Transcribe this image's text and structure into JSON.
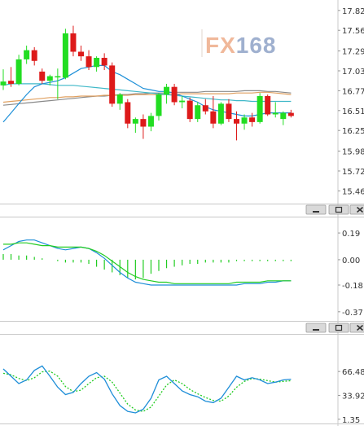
{
  "chart_data": [
    {
      "type": "candlestick",
      "panel": "price",
      "watermark": "FX168",
      "y_ticks": [
        "17.82",
        "17.56",
        "17.29",
        "17.03",
        "16.77",
        "16.51",
        "16.25",
        "15.98",
        "15.72",
        "15.46"
      ],
      "ylim": [
        15.4,
        17.85
      ],
      "candles": [
        {
          "o": 16.84,
          "h": 17.05,
          "l": 16.78,
          "c": 16.89
        },
        {
          "o": 16.9,
          "h": 17.08,
          "l": 16.82,
          "c": 16.86
        },
        {
          "o": 16.86,
          "h": 17.24,
          "l": 16.84,
          "c": 17.18
        },
        {
          "o": 17.18,
          "h": 17.36,
          "l": 17.12,
          "c": 17.3
        },
        {
          "o": 17.3,
          "h": 17.34,
          "l": 17.1,
          "c": 17.16
        },
        {
          "o": 17.02,
          "h": 17.06,
          "l": 16.86,
          "c": 16.9
        },
        {
          "o": 16.9,
          "h": 16.98,
          "l": 16.84,
          "c": 16.96
        },
        {
          "o": 16.96,
          "h": 17.06,
          "l": 16.66,
          "c": 16.96
        },
        {
          "o": 16.94,
          "h": 17.58,
          "l": 16.92,
          "c": 17.52
        },
        {
          "o": 17.52,
          "h": 17.62,
          "l": 17.22,
          "c": 17.28
        },
        {
          "o": 17.28,
          "h": 17.36,
          "l": 17.16,
          "c": 17.22
        },
        {
          "o": 17.22,
          "h": 17.3,
          "l": 17.04,
          "c": 17.08
        },
        {
          "o": 17.08,
          "h": 17.22,
          "l": 17.02,
          "c": 17.2
        },
        {
          "o": 17.2,
          "h": 17.26,
          "l": 17.04,
          "c": 17.1
        },
        {
          "o": 17.1,
          "h": 17.14,
          "l": 16.56,
          "c": 16.6
        },
        {
          "o": 16.6,
          "h": 16.74,
          "l": 16.52,
          "c": 16.72
        },
        {
          "o": 16.62,
          "h": 16.66,
          "l": 16.28,
          "c": 16.34
        },
        {
          "o": 16.34,
          "h": 16.42,
          "l": 16.22,
          "c": 16.4
        },
        {
          "o": 16.4,
          "h": 16.46,
          "l": 16.14,
          "c": 16.3
        },
        {
          "o": 16.3,
          "h": 16.48,
          "l": 16.24,
          "c": 16.44
        },
        {
          "o": 16.44,
          "h": 16.74,
          "l": 16.38,
          "c": 16.72
        },
        {
          "o": 16.72,
          "h": 16.86,
          "l": 16.6,
          "c": 16.82
        },
        {
          "o": 16.82,
          "h": 16.86,
          "l": 16.58,
          "c": 16.62
        },
        {
          "o": 16.62,
          "h": 16.7,
          "l": 16.54,
          "c": 16.64
        },
        {
          "o": 16.64,
          "h": 16.68,
          "l": 16.36,
          "c": 16.4
        },
        {
          "o": 16.4,
          "h": 16.62,
          "l": 16.36,
          "c": 16.58
        },
        {
          "o": 16.58,
          "h": 16.66,
          "l": 16.46,
          "c": 16.5
        },
        {
          "o": 16.5,
          "h": 16.7,
          "l": 16.28,
          "c": 16.34
        },
        {
          "o": 16.34,
          "h": 16.62,
          "l": 16.32,
          "c": 16.6
        },
        {
          "o": 16.6,
          "h": 16.66,
          "l": 16.36,
          "c": 16.4
        },
        {
          "o": 16.4,
          "h": 16.5,
          "l": 16.12,
          "c": 16.34
        },
        {
          "o": 16.34,
          "h": 16.46,
          "l": 16.26,
          "c": 16.42
        },
        {
          "o": 16.42,
          "h": 16.48,
          "l": 16.3,
          "c": 16.36
        },
        {
          "o": 16.36,
          "h": 16.74,
          "l": 16.34,
          "c": 16.7
        },
        {
          "o": 16.7,
          "h": 16.72,
          "l": 16.44,
          "c": 16.46
        },
        {
          "o": 16.46,
          "h": 16.62,
          "l": 16.42,
          "c": 16.48
        },
        {
          "o": 16.4,
          "h": 16.5,
          "l": 16.32,
          "c": 16.48
        },
        {
          "o": 16.48,
          "h": 16.52,
          "l": 16.42,
          "c": 16.44
        }
      ],
      "overlay_lines": [
        {
          "color": "#1e90d8",
          "values": [
            16.36,
            16.48,
            16.6,
            16.72,
            16.82,
            16.86,
            16.88,
            16.9,
            16.94,
            17.0,
            17.06,
            17.08,
            17.1,
            17.1,
            17.02,
            16.98,
            16.92,
            16.86,
            16.8,
            16.78,
            16.76,
            16.76,
            16.74,
            16.7,
            16.66,
            16.62,
            16.56,
            16.52,
            16.5,
            16.48,
            16.46,
            16.44,
            16.44,
            16.46,
            16.48,
            16.48,
            16.48,
            16.48
          ]
        },
        {
          "color": "#3fb8c8",
          "values": [
            16.84,
            16.86,
            16.86,
            16.86,
            16.86,
            16.86,
            16.85,
            16.84,
            16.84,
            16.84,
            16.83,
            16.82,
            16.81,
            16.8,
            16.79,
            16.78,
            16.77,
            16.76,
            16.75,
            16.74,
            16.73,
            16.72,
            16.71,
            16.7,
            16.69,
            16.68,
            16.67,
            16.66,
            16.65,
            16.65,
            16.64,
            16.64,
            16.63,
            16.63,
            16.63,
            16.63,
            16.63,
            16.63
          ]
        },
        {
          "color": "#e0a060",
          "values": [
            16.62,
            16.63,
            16.64,
            16.65,
            16.66,
            16.67,
            16.68,
            16.68,
            16.69,
            16.69,
            16.7,
            16.7,
            16.7,
            16.71,
            16.71,
            16.71,
            16.71,
            16.72,
            16.72,
            16.72,
            16.72,
            16.72,
            16.72,
            16.73,
            16.73,
            16.73,
            16.73,
            16.73,
            16.73,
            16.73,
            16.74,
            16.74,
            16.74,
            16.75,
            16.75,
            16.74,
            16.73,
            16.72
          ]
        },
        {
          "color": "#8a8a8a",
          "values": [
            16.58,
            16.59,
            16.6,
            16.61,
            16.62,
            16.63,
            16.64,
            16.65,
            16.66,
            16.67,
            16.68,
            16.69,
            16.7,
            16.7,
            16.71,
            16.72,
            16.72,
            16.73,
            16.73,
            16.74,
            16.74,
            16.74,
            16.75,
            16.75,
            16.75,
            16.75,
            16.76,
            16.76,
            16.76,
            16.76,
            16.76,
            16.77,
            16.77,
            16.77,
            16.76,
            16.76,
            16.75,
            16.74
          ]
        }
      ]
    },
    {
      "type": "macd",
      "panel": "indicator",
      "y_ticks": [
        "0.19",
        "0.00",
        "-0.18",
        "-0.37"
      ],
      "ylim": [
        -0.4,
        0.26
      ],
      "line_main": [
        0.11,
        0.11,
        0.12,
        0.12,
        0.11,
        0.1,
        0.1,
        0.09,
        0.09,
        0.09,
        0.09,
        0.08,
        0.06,
        0.03,
        -0.01,
        -0.05,
        -0.09,
        -0.12,
        -0.14,
        -0.15,
        -0.16,
        -0.16,
        -0.17,
        -0.17,
        -0.17,
        -0.17,
        -0.17,
        -0.17,
        -0.17,
        -0.17,
        -0.16,
        -0.16,
        -0.16,
        -0.16,
        -0.15,
        -0.15,
        -0.15,
        -0.15
      ],
      "line_signal": [
        0.07,
        0.1,
        0.13,
        0.14,
        0.14,
        0.12,
        0.1,
        0.08,
        0.07,
        0.08,
        0.09,
        0.08,
        0.05,
        0.01,
        -0.04,
        -0.09,
        -0.13,
        -0.16,
        -0.17,
        -0.18,
        -0.18,
        -0.18,
        -0.18,
        -0.18,
        -0.18,
        -0.18,
        -0.18,
        -0.18,
        -0.18,
        -0.18,
        -0.18,
        -0.17,
        -0.17,
        -0.17,
        -0.16,
        -0.16,
        -0.15,
        -0.15
      ],
      "histogram": [
        0.04,
        0.04,
        0.03,
        0.03,
        0.02,
        0.01,
        0.0,
        -0.01,
        -0.02,
        -0.02,
        -0.02,
        -0.03,
        -0.05,
        -0.07,
        -0.09,
        -0.11,
        -0.13,
        -0.14,
        -0.13,
        -0.1,
        -0.08,
        -0.06,
        -0.05,
        -0.04,
        -0.03,
        -0.03,
        -0.02,
        -0.02,
        -0.02,
        -0.02,
        -0.01,
        -0.01,
        -0.01,
        -0.01,
        -0.01,
        -0.01,
        -0.01,
        -0.01
      ]
    },
    {
      "type": "stochastic",
      "panel": "oscillator",
      "y_ticks": [
        "66.48",
        "33.92",
        "1.35"
      ],
      "ylim": [
        0,
        100
      ],
      "line_k": [
        70,
        60,
        50,
        55,
        68,
        74,
        60,
        45,
        35,
        38,
        50,
        60,
        65,
        56,
        36,
        20,
        12,
        10,
        15,
        30,
        55,
        60,
        50,
        40,
        35,
        32,
        26,
        24,
        30,
        45,
        60,
        55,
        58,
        55,
        50,
        52,
        55,
        56
      ],
      "line_d": [
        64,
        62,
        57,
        54,
        58,
        66,
        67,
        60,
        46,
        39,
        41,
        50,
        58,
        60,
        52,
        37,
        22,
        14,
        12,
        18,
        33,
        48,
        55,
        50,
        42,
        36,
        31,
        27,
        26,
        33,
        45,
        53,
        57,
        56,
        54,
        52,
        53,
        54
      ]
    }
  ],
  "panel_buttons": [
    {
      "panel": "indicator",
      "buttons": [
        "minimize",
        "maximize",
        "close"
      ]
    },
    {
      "panel": "oscillator",
      "buttons": [
        "minimize",
        "maximize",
        "close"
      ]
    }
  ]
}
